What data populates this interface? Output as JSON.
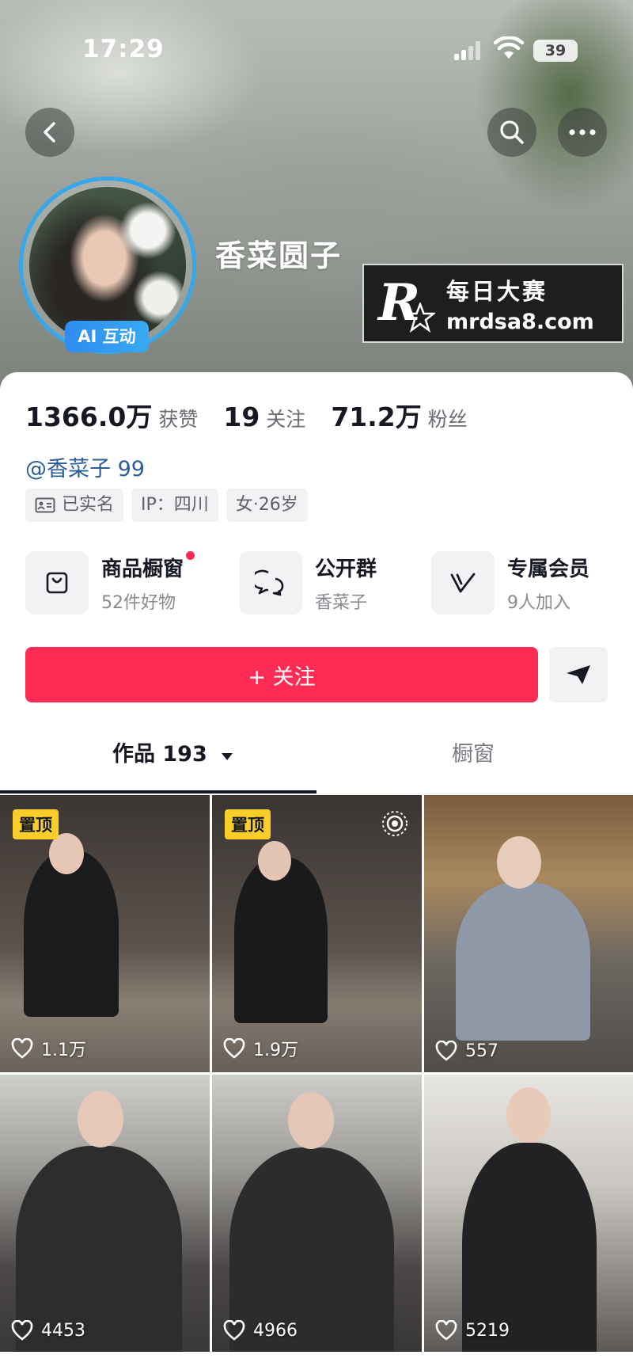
{
  "status_bar": {
    "time": "17:29",
    "battery": "39"
  },
  "profile": {
    "nickname": "香菜圆子",
    "ai_badge": "AI 互动",
    "handle": "@香菜子 99"
  },
  "watermark": {
    "brand_cn": "每日大赛",
    "url": "mrdsa8.com",
    "logo_letter": "R"
  },
  "stats": [
    {
      "value": "1366.0万",
      "label": "获赞"
    },
    {
      "value": "19",
      "label": "关注"
    },
    {
      "value": "71.2万",
      "label": "粉丝"
    }
  ],
  "tags": [
    {
      "label": "已实名",
      "icon": "id-card-icon"
    },
    {
      "label": "IP：四川"
    },
    {
      "label": "女·26岁"
    }
  ],
  "features": [
    {
      "title": "商品橱窗",
      "subtitle": "52件好物",
      "icon": "shopping-bag-icon",
      "has_dot": true
    },
    {
      "title": "公开群",
      "subtitle": "香菜子",
      "icon": "group-chat-icon"
    },
    {
      "title": "专属会员",
      "subtitle": "9人加入",
      "icon": "membership-icon"
    }
  ],
  "actions": {
    "follow_label": "+ 关注"
  },
  "tabs": {
    "works": "作品 193",
    "window": "橱窗"
  },
  "videos": [
    {
      "likes": "1.1万",
      "pinned": true,
      "pin_label": "置顶"
    },
    {
      "likes": "1.9万",
      "pinned": true,
      "pin_label": "置顶"
    },
    {
      "likes": "557"
    },
    {
      "likes": "4453"
    },
    {
      "likes": "4966"
    },
    {
      "likes": "5219"
    }
  ],
  "colors": {
    "accent": "#fe2c55",
    "handle": "#2a5d9a",
    "ai_badge": "#2f8cf0",
    "pin": "#facd2b"
  }
}
